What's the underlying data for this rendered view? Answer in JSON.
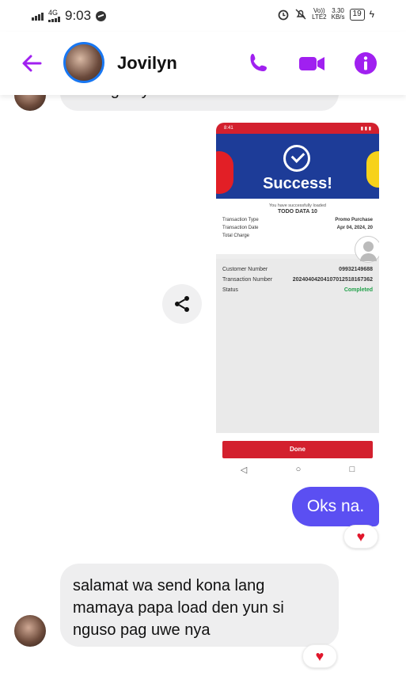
{
  "status_bar": {
    "network": "4G",
    "time": "9:03",
    "volte_top": "Vo))",
    "volte_bottom": "LTE2",
    "speed_top": "3.30",
    "speed_bottom": "KB/s",
    "battery": "19"
  },
  "header": {
    "contact_name": "Jovilyn",
    "accent_color": "#a020f0"
  },
  "messages": {
    "partial_previous_text": "wm ng bayan e",
    "screenshot": {
      "hero_title": "Success!",
      "loaded_line": "You have successfully loaded",
      "loaded_name": "TODO DATA 10",
      "rows": [
        {
          "label": "Transaction Type",
          "value": "Promo Purchase"
        },
        {
          "label": "Transaction Date",
          "value": "Apr 04, 2024, 20"
        },
        {
          "label": "Total Charge",
          "value": ""
        }
      ],
      "rows2": [
        {
          "label": "Customer Number",
          "value": "09932149688"
        },
        {
          "label": "Transaction Number",
          "value": "20240404204107012518167362"
        },
        {
          "label": "Status",
          "value": "Completed"
        }
      ],
      "done_label": "Done",
      "status_time": "8:41"
    },
    "my_message": "Oks na.",
    "their_message_line1": "salamat wa send kona lang",
    "their_message_line2": "mamaya papa load den yun si",
    "their_message_line3": "nguso pag uwe nya",
    "reaction_emoji": "♥"
  }
}
